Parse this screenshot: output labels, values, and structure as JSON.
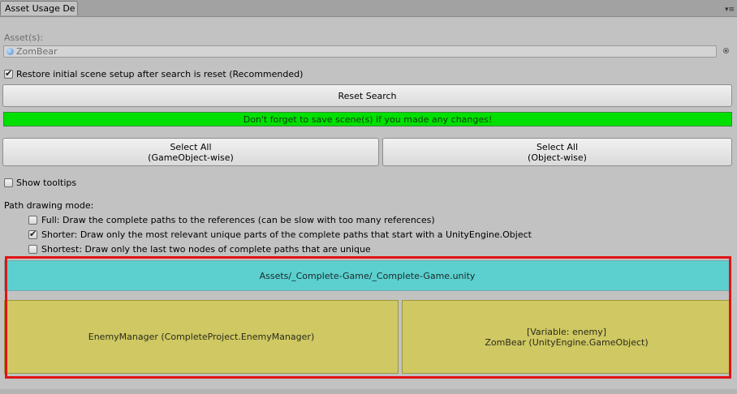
{
  "window": {
    "tab_title": "Asset Usage De",
    "menu_icon": "menu-icon"
  },
  "assets": {
    "label": "Asset(s):",
    "field_value": "ZomBear",
    "field_icon": "gameobject-icon",
    "picker_icon": "object-picker-icon"
  },
  "options": {
    "restore_scene": {
      "label": "Restore initial scene setup after search is reset (Recommended)",
      "checked": true
    },
    "show_tooltips": {
      "label": "Show tooltips",
      "checked": false
    }
  },
  "buttons": {
    "reset_search": "Reset Search",
    "select_all_gameobject": {
      "line1": "Select All",
      "line2": "(GameObject-wise)"
    },
    "select_all_object": {
      "line1": "Select All",
      "line2": "(Object-wise)"
    }
  },
  "banner": {
    "text": "Don't forget to save scene(s) if you made any changes!",
    "color": "#00e000"
  },
  "path_mode": {
    "label": "Path drawing mode:",
    "items": [
      {
        "label": "Full: Draw the complete paths to the references (can be slow with too many references)",
        "checked": false
      },
      {
        "label": "Shorter: Draw only the most relevant unique parts of the complete paths that start with a UnityEngine.Object",
        "checked": true
      },
      {
        "label": "Shortest: Draw only the last two nodes of complete paths that are unique",
        "checked": false
      }
    ]
  },
  "results": {
    "scene_path": "Assets/_Complete-Game/_Complete-Game.unity",
    "left_node": "EnemyManager (CompleteProject.EnemyManager)",
    "right_node": {
      "line1": "[Variable: enemy]",
      "line2": "ZomBear (UnityEngine.GameObject)"
    },
    "colors": {
      "header": "#5ccfcf",
      "node": "#cfc863",
      "highlight": "#e01414"
    }
  }
}
